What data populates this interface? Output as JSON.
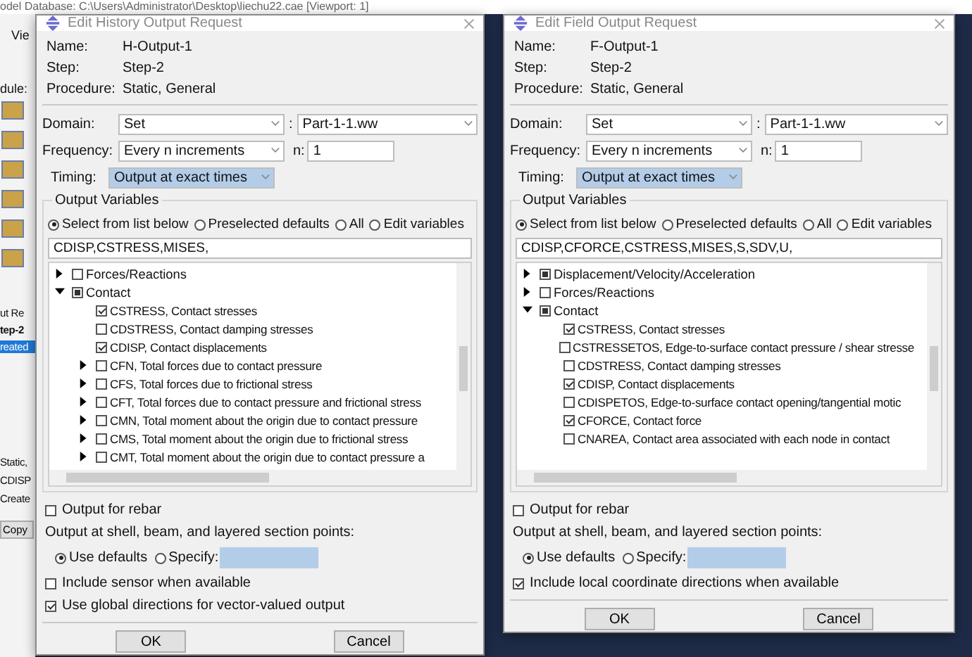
{
  "app": {
    "title": "odel Database: C:\\Users\\Administrator\\Desktop\\liechu22.cae [Viewport: 1]",
    "menu": "Vie",
    "module_label": "dule:",
    "panel_texts": [
      "ut Re",
      "tep-2"
    ],
    "selected_text": "reated",
    "info_texts": [
      "Static,",
      "CDISP",
      "Create"
    ],
    "copy_button": "Copy"
  },
  "dialogs": [
    {
      "title": "Edit History Output Request",
      "name_label": "Name:",
      "name": "H-Output-1",
      "step_label": "Step:",
      "step": "Step-2",
      "procedure_label": "Procedure:",
      "procedure": "Static, General",
      "domain_label": "Domain:",
      "domain": "Set",
      "domain_separator": ":",
      "domain_target": "Part-1-1.ww",
      "frequency_label": "Frequency:",
      "frequency": "Every n increments",
      "n_label": "n:",
      "n": "1",
      "timing_label": "Timing:",
      "timing": "Output at exact times",
      "group_title": "Output Variables",
      "modes": [
        {
          "label": "Select from list below",
          "selected": true
        },
        {
          "label": "Preselected defaults",
          "selected": false
        },
        {
          "label": "All",
          "selected": false
        },
        {
          "label": "Edit variables",
          "selected": false
        }
      ],
      "variables": "CDISP,CSTRESS,MISES,",
      "tree": [
        {
          "kind": "group",
          "label": "Forces/Reactions",
          "checked": false,
          "expanded": false
        },
        {
          "kind": "group",
          "label": "Contact",
          "checked": true,
          "expanded": true,
          "children": [
            {
              "kind": "variable",
              "label": "CSTRESS, Contact stresses",
              "checked": true
            },
            {
              "kind": "variable",
              "label": "CDSTRESS, Contact damping stresses",
              "checked": false
            },
            {
              "kind": "variable",
              "label": "CDISP, Contact displacements",
              "checked": true
            },
            {
              "kind": "variable",
              "label": "CFN, Total forces due to contact pressure",
              "checked": false,
              "expanded": false
            },
            {
              "kind": "variable",
              "label": "CFS, Total forces due to frictional stress",
              "checked": false,
              "expanded": false
            },
            {
              "kind": "variable",
              "label": "CFT, Total forces due to contact pressure and frictional stress",
              "checked": false,
              "expanded": false
            },
            {
              "kind": "variable",
              "label": "CMN, Total moment about the origin due to contact pressure",
              "checked": false,
              "expanded": false
            },
            {
              "kind": "variable",
              "label": "CMS, Total moment about the origin due to frictional stress",
              "checked": false,
              "expanded": false
            },
            {
              "kind": "variable",
              "label": "CMT, Total moment about the origin due to contact pressure a",
              "checked": false,
              "expanded": false
            }
          ]
        }
      ],
      "options": [
        {
          "kind": "checkbox",
          "label": "Output for rebar",
          "checked": false
        },
        {
          "kind": "label",
          "label": "Output at shell, beam, and layered section points:"
        },
        {
          "kind": "radios",
          "options": [
            {
              "label": "Use defaults",
              "selected": true
            },
            {
              "label": "Specify:",
              "selected": false
            }
          ]
        },
        {
          "kind": "checkbox",
          "label": "Include sensor when available",
          "checked": false
        },
        {
          "kind": "checkbox",
          "label": "Use global directions for vector-valued output",
          "checked": true
        }
      ],
      "buttons": [
        "OK",
        "Cancel"
      ]
    },
    {
      "title": "Edit Field Output Request",
      "name_label": "Name:",
      "name": "F-Output-1",
      "step_label": "Step:",
      "step": "Step-2",
      "procedure_label": "Procedure:",
      "procedure": "Static, General",
      "domain_label": "Domain:",
      "domain": "Set",
      "domain_separator": ":",
      "domain_target": "Part-1-1.ww",
      "frequency_label": "Frequency:",
      "frequency": "Every n increments",
      "n_label": "n:",
      "n": "1",
      "timing_label": "Timing:",
      "timing": "Output at exact times",
      "group_title": "Output Variables",
      "modes": [
        {
          "label": "Select from list below",
          "selected": true
        },
        {
          "label": "Preselected defaults",
          "selected": false
        },
        {
          "label": "All",
          "selected": false
        },
        {
          "label": "Edit variables",
          "selected": false
        }
      ],
      "variables": "CDISP,CFORCE,CSTRESS,MISES,S,SDV,U,",
      "tree": [
        {
          "kind": "group",
          "label": "Displacement/Velocity/Acceleration",
          "checked": true,
          "expanded": false
        },
        {
          "kind": "group",
          "label": "Forces/Reactions",
          "checked": false,
          "expanded": false
        },
        {
          "kind": "group",
          "label": "Contact",
          "checked": true,
          "expanded": true,
          "children": [
            {
              "kind": "variable",
              "label": "CSTRESS, Contact stresses",
              "checked": true
            },
            {
              "kind": "variable",
              "label": "CSTRESSETOS, Edge-to-surface contact pressure / shear stresse",
              "checked": false
            },
            {
              "kind": "variable",
              "label": "CDSTRESS, Contact damping stresses",
              "checked": false
            },
            {
              "kind": "variable",
              "label": "CDISP, Contact displacements",
              "checked": true
            },
            {
              "kind": "variable",
              "label": "CDISPETOS, Edge-to-surface contact opening/tangential motic",
              "checked": false
            },
            {
              "kind": "variable",
              "label": "CFORCE, Contact force",
              "checked": true
            },
            {
              "kind": "variable",
              "label": "CNAREA, Contact area associated with each node in contact",
              "checked": false
            }
          ]
        }
      ],
      "options": [
        {
          "kind": "checkbox",
          "label": "Output for rebar",
          "checked": false
        },
        {
          "kind": "label",
          "label": "Output at shell, beam, and layered section points:"
        },
        {
          "kind": "radios",
          "options": [
            {
              "label": "Use defaults",
              "selected": true
            },
            {
              "label": "Specify:",
              "selected": false
            }
          ]
        },
        {
          "kind": "checkbox",
          "label": "Include local coordinate directions when available",
          "checked": true
        }
      ],
      "buttons": [
        "OK",
        "Cancel"
      ]
    }
  ]
}
